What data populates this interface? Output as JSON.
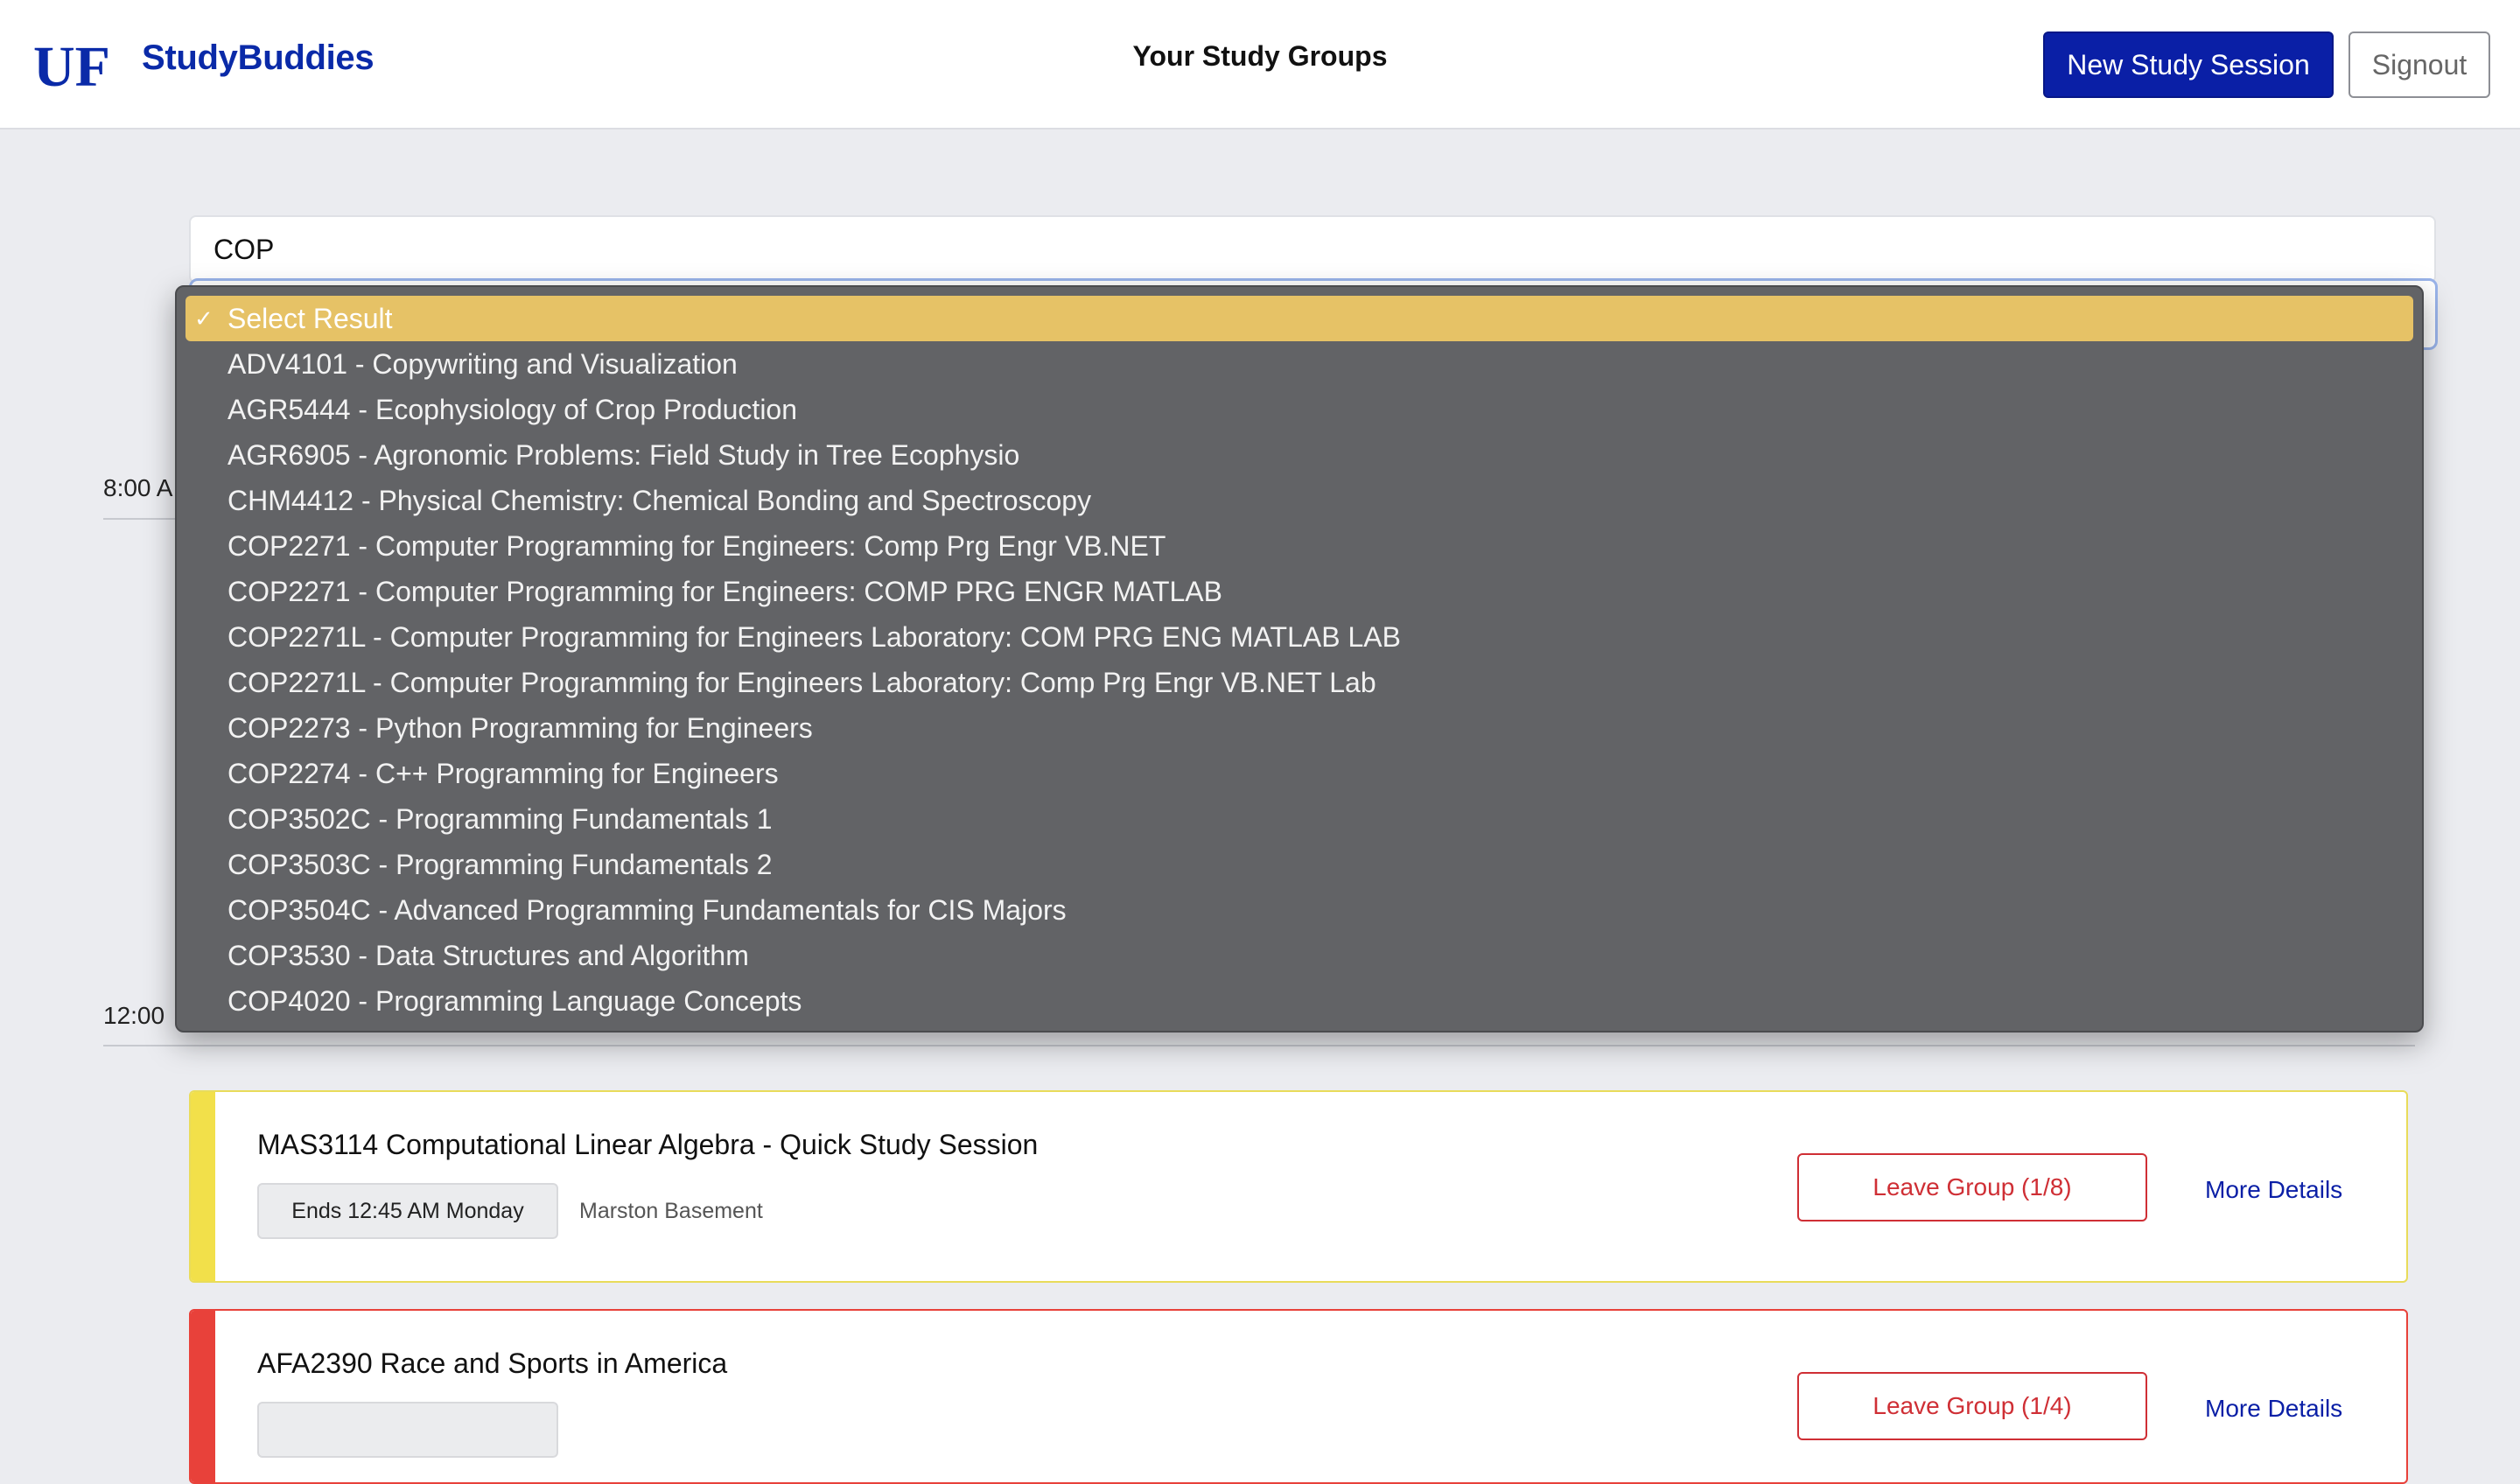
{
  "header": {
    "brand_logo_text": "UF",
    "brand_name": "StudyBuddies",
    "title": "Your Study Groups",
    "new_session_label": "New Study Session",
    "signout_label": "Signout"
  },
  "search": {
    "value": "COP"
  },
  "timeline": {
    "labels": [
      "8:00 A",
      "12:00"
    ]
  },
  "dropdown": {
    "selected_label": "Select Result",
    "options": [
      "ADV4101 - Copywriting and Visualization",
      "AGR5444 - Ecophysiology of Crop Production",
      "AGR6905 - Agronomic Problems: Field Study in Tree Ecophysio",
      "CHM4412 - Physical Chemistry: Chemical Bonding and Spectroscopy",
      "COP2271 - Computer Programming for Engineers: Comp Prg Engr VB.NET",
      "COP2271 - Computer Programming for Engineers: COMP PRG ENGR MATLAB",
      "COP2271L - Computer Programming for Engineers Laboratory: COM PRG ENG MATLAB LAB",
      "COP2271L - Computer Programming for Engineers Laboratory: Comp Prg Engr VB.NET Lab",
      "COP2273 - Python Programming for Engineers",
      "COP2274 - C++ Programming for Engineers",
      "COP3502C - Programming Fundamentals 1",
      "COP3503C - Programming Fundamentals 2",
      "COP3504C - Advanced Programming Fundamentals for CIS Majors",
      "COP3530 - Data Structures and Algorithm",
      "COP4020 - Programming Language Concepts"
    ]
  },
  "cards": [
    {
      "title": "MAS3114 Computational Linear Algebra - Quick Study Session",
      "ends": "Ends 12:45 AM Monday",
      "location": "Marston Basement",
      "leave_label": "Leave Group (1/8)",
      "more_label": "More Details",
      "accent": "#f2e04a"
    },
    {
      "title": "AFA2390 Race and Sports in America",
      "leave_label": "Leave Group (1/4)",
      "more_label": "More Details",
      "accent": "#e8413a"
    }
  ],
  "colors": {
    "brand_blue": "#0a1fa6",
    "leave_red": "#cf2f35",
    "dropdown_bg": "#626366",
    "dropdown_selected": "#e6c266"
  }
}
